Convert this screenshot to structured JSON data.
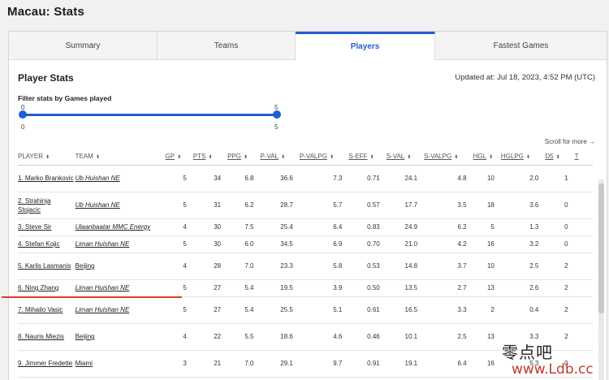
{
  "page": {
    "title": "Macau: Stats"
  },
  "tabs": [
    {
      "label": "Summary"
    },
    {
      "label": "Teams"
    },
    {
      "label": "Players"
    },
    {
      "label": "Fastest Games"
    }
  ],
  "section": {
    "title": "Player Stats",
    "updated": "Updated at: Jul 18, 2023, 4:52 PM (UTC)"
  },
  "filter": {
    "label": "Filter stats by Games played",
    "min": "0",
    "max": "5",
    "range_min_label": "0",
    "range_max_label": "5",
    "selected_min": 0,
    "selected_max": 5
  },
  "scroll_hint": "Scroll for more →",
  "table": {
    "columns": [
      "PLAYER",
      "TEAM",
      "GP",
      "PTS",
      "PPG",
      "P-VAL",
      "P-VALPG",
      "S-EFF",
      "S-VAL",
      "S-VALPG",
      "HGL",
      "HGLPG",
      "D5",
      "T"
    ],
    "rows": [
      {
        "player": "1. Marko Brankovic",
        "team": "Ub Huishan NE",
        "gp": "5",
        "pts": "34",
        "ppg": "6.8",
        "pval": "36.6",
        "pvalpg": "7.3",
        "seff": "0.71",
        "sval": "24.1",
        "svalpg": "4.8",
        "hgl": "10",
        "hglpg": "2.0",
        "d5": "1"
      },
      {
        "player": "2. Strahinja Stojacic",
        "team": "Ub Huishan NE",
        "gp": "5",
        "pts": "31",
        "ppg": "6.2",
        "pval": "28.7",
        "pvalpg": "5.7",
        "seff": "0.57",
        "sval": "17.7",
        "svalpg": "3.5",
        "hgl": "18",
        "hglpg": "3.6",
        "d5": "0"
      },
      {
        "player": "3. Steve Sir",
        "team": "Ulaanbaatar MMC Energy",
        "gp": "4",
        "pts": "30",
        "ppg": "7.5",
        "pval": "25.4",
        "pvalpg": "6.4",
        "seff": "0.83",
        "sval": "24.9",
        "svalpg": "6.2",
        "hgl": "5",
        "hglpg": "1.3",
        "d5": "0"
      },
      {
        "player": "4. Stefan Kojic",
        "team": "Liman Huishan NE",
        "gp": "5",
        "pts": "30",
        "ppg": "6.0",
        "pval": "34.5",
        "pvalpg": "6.9",
        "seff": "0.70",
        "sval": "21.0",
        "svalpg": "4.2",
        "hgl": "16",
        "hglpg": "3.2",
        "d5": "0"
      },
      {
        "player": "5. Karlis Lasmanis",
        "team": "Beijing",
        "gp": "4",
        "pts": "28",
        "ppg": "7.0",
        "pval": "23.3",
        "pvalpg": "5.8",
        "seff": "0.53",
        "sval": "14.8",
        "svalpg": "3.7",
        "hgl": "10",
        "hglpg": "2.5",
        "d5": "2"
      },
      {
        "player": "6. Ning Zhang",
        "team": "Liman Huishan NE",
        "gp": "5",
        "pts": "27",
        "ppg": "5.4",
        "pval": "19.5",
        "pvalpg": "3.9",
        "seff": "0.50",
        "sval": "13.5",
        "svalpg": "2.7",
        "hgl": "13",
        "hglpg": "2.6",
        "d5": "2"
      },
      {
        "player": "7. Mihailo Vasic",
        "team": "Liman Huishan NE",
        "gp": "5",
        "pts": "27",
        "ppg": "5.4",
        "pval": "25.5",
        "pvalpg": "5.1",
        "seff": "0.61",
        "sval": "16.5",
        "svalpg": "3.3",
        "hgl": "2",
        "hglpg": "0.4",
        "d5": "2"
      },
      {
        "player": "8. Nauris Miezis",
        "team": "Beijing",
        "gp": "4",
        "pts": "22",
        "ppg": "5.5",
        "pval": "18.6",
        "pvalpg": "4.6",
        "seff": "0.46",
        "sval": "10.1",
        "svalpg": "2.5",
        "hgl": "13",
        "hglpg": "3.3",
        "d5": "2"
      },
      {
        "player": "9. Jimmer Fredette",
        "team": "Miami",
        "gp": "3",
        "pts": "21",
        "ppg": "7.0",
        "pval": "29.1",
        "pvalpg": "9.7",
        "seff": "0.91",
        "sval": "19.1",
        "svalpg": "6.4",
        "hgl": "16",
        "hglpg": "5.3",
        "d5": "0"
      }
    ]
  },
  "watermark": {
    "text": "零点吧",
    "url": "www.Ldb.cc"
  },
  "colors": {
    "accent": "#1f5fd1",
    "highlight_line": "#e0392b"
  }
}
